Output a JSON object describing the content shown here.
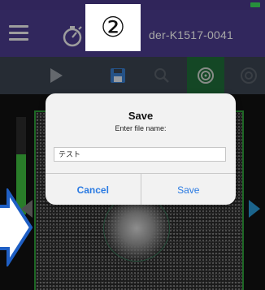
{
  "header": {
    "device_title": "der-K1517-0041",
    "step_badge": "②"
  },
  "toolbar": {
    "tools": [
      "play-icon",
      "save-icon",
      "search-icon",
      "target-icon"
    ],
    "active_tool": "target-icon"
  },
  "viewer": {
    "signal_level": 0.62
  },
  "dialog": {
    "title": "Save",
    "message": "Enter file name:",
    "filename_value": "テスト",
    "cancel_label": "Cancel",
    "save_label": "Save"
  },
  "colors": {
    "header": "#4c3d8f",
    "toolbar": "#3b4451",
    "active_tool": "#1f6e3a",
    "accent_blue": "#2a9ad8",
    "dialog_button": "#2a7ae2",
    "scan_frame": "#2f9e3a"
  }
}
